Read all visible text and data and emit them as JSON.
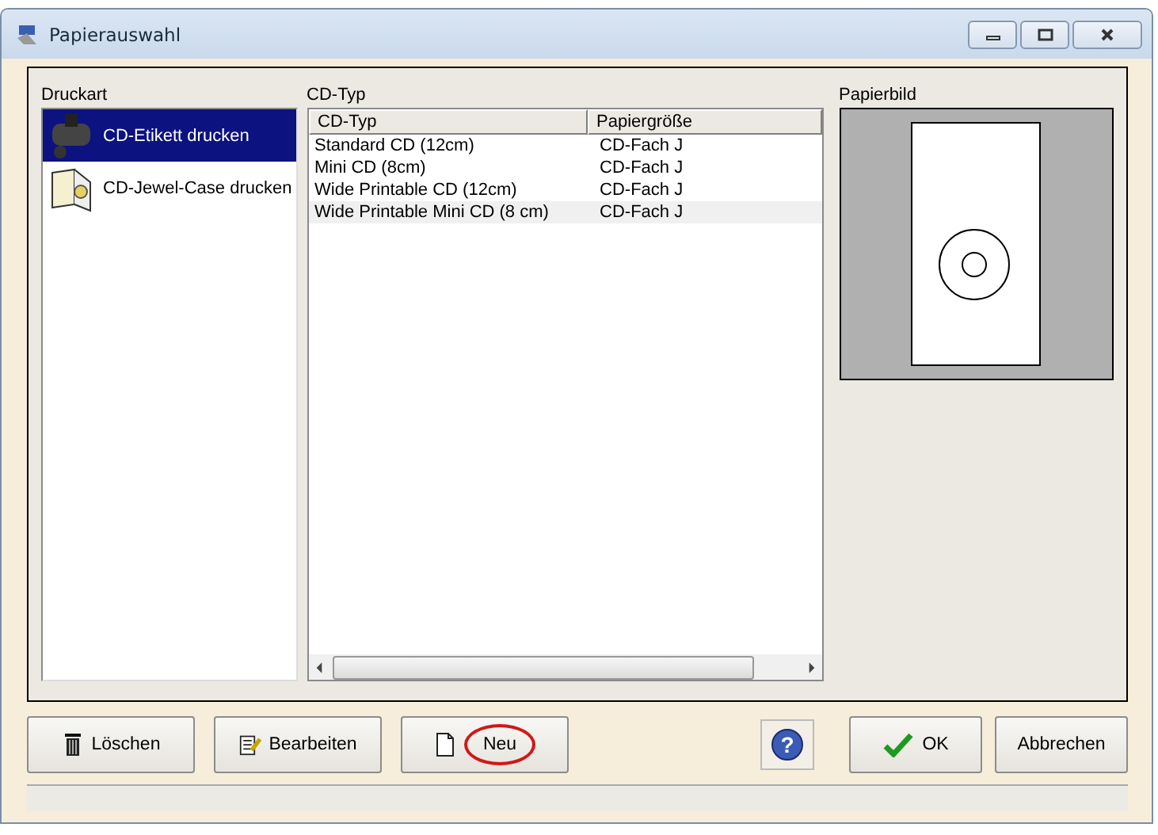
{
  "window": {
    "title": "Papierauswahl"
  },
  "druckart": {
    "label": "Druckart",
    "items": [
      {
        "label": "CD-Etikett drucken",
        "kind": "printer",
        "selected": true
      },
      {
        "label": "CD-Jewel-Case drucken",
        "kind": "case",
        "selected": false
      }
    ]
  },
  "cd_typ": {
    "label": "CD-Typ",
    "columns": [
      "CD-Typ",
      "Papiergröße"
    ],
    "rows": [
      {
        "cells": [
          "Standard CD (12cm)",
          "CD-Fach J"
        ],
        "selected": false
      },
      {
        "cells": [
          "Mini CD (8cm)",
          "CD-Fach J"
        ],
        "selected": false
      },
      {
        "cells": [
          "Wide Printable CD (12cm)",
          "CD-Fach J"
        ],
        "selected": false
      },
      {
        "cells": [
          "Wide Printable Mini CD (8 cm)",
          "CD-Fach J"
        ],
        "selected": true
      }
    ]
  },
  "papierbild": {
    "label": "Papierbild"
  },
  "buttons": [
    {
      "label": "Löschen",
      "kind": "delete"
    },
    {
      "label": "Bearbeiten",
      "kind": "edit"
    },
    {
      "label": "Neu",
      "kind": "new",
      "circled": true
    }
  ],
  "right_buttons": [
    {
      "label": "?",
      "kind": "help"
    },
    {
      "label": "OK",
      "kind": "ok"
    },
    {
      "label": "Abbrechen",
      "kind": "cancel"
    }
  ]
}
